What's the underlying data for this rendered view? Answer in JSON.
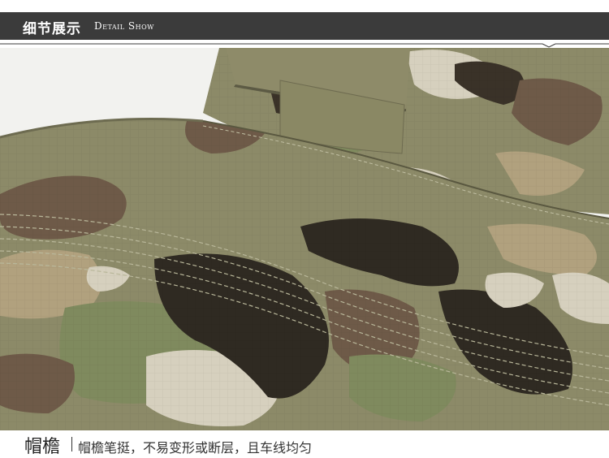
{
  "header": {
    "title": "细节展示",
    "subtitle": "Detail Show"
  },
  "photo": {
    "subject": "camouflage-cap-brim",
    "colors": {
      "base": "#8c8a68",
      "dark": "#2f2a22",
      "brown": "#6e5a48",
      "light": "#d6d0be",
      "green": "#7f8a5e",
      "tan": "#b1a17e"
    }
  },
  "caption": {
    "title": "帽檐",
    "description": "帽檐笔挺，不易变形或断层，且车线均匀"
  }
}
